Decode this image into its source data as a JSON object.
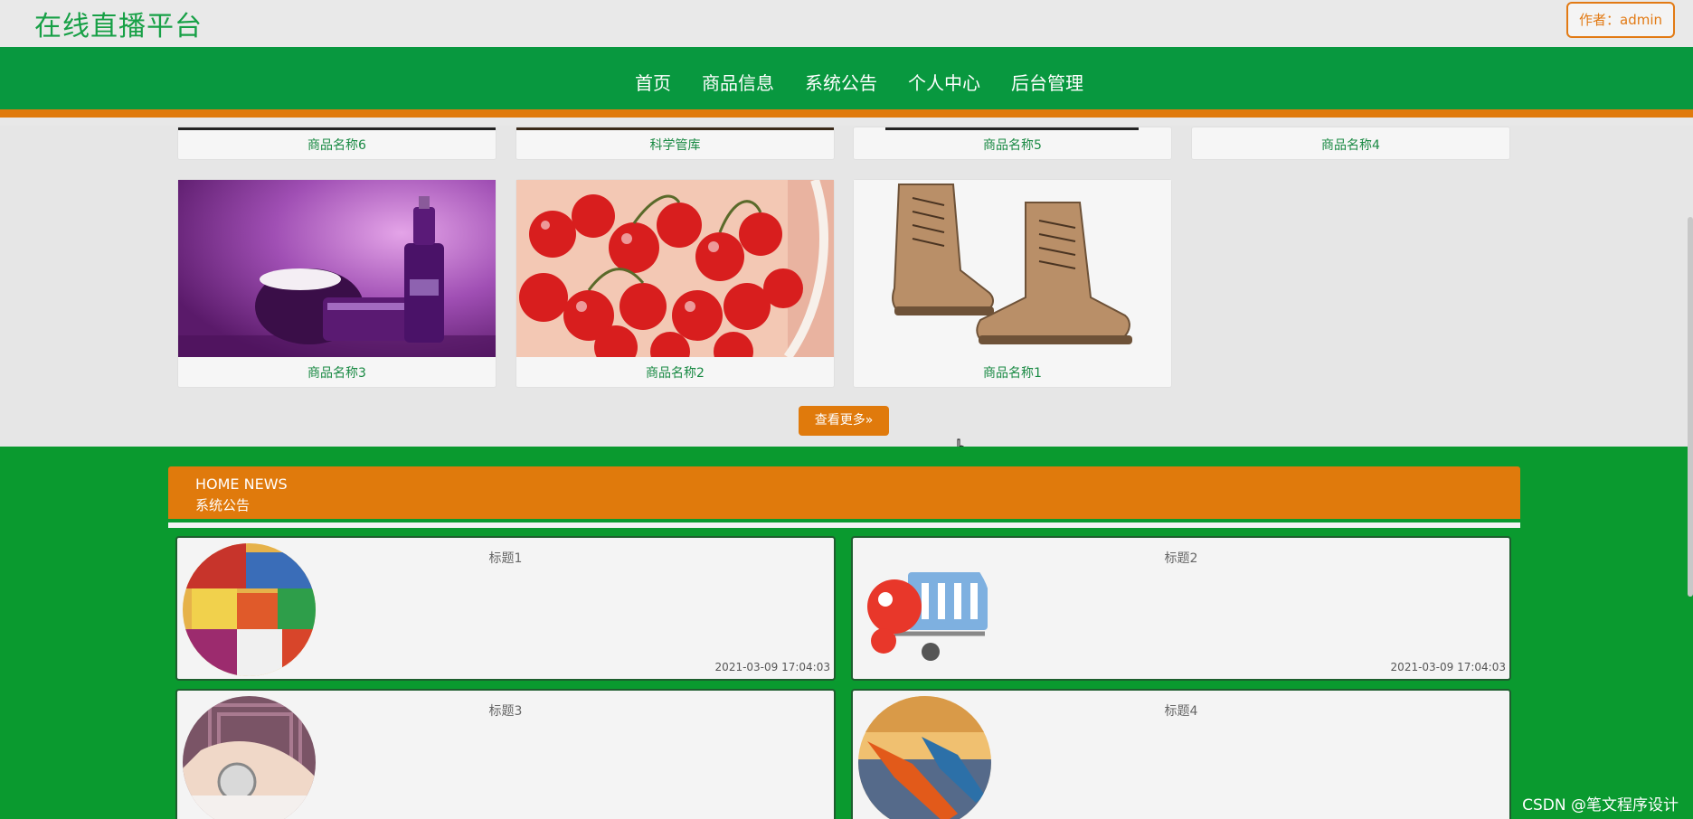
{
  "header": {
    "site_title": "在线直播平台",
    "author_label": "作者：admin"
  },
  "nav": {
    "items": [
      "首页",
      "商品信息",
      "系统公告",
      "个人中心",
      "后台管理"
    ]
  },
  "products": {
    "row1": [
      "商品名称6",
      "科学管库",
      "商品名称5",
      "商品名称4"
    ],
    "row2": [
      "商品名称3",
      "商品名称2",
      "商品名称1"
    ],
    "more_label": "查看更多»"
  },
  "news": {
    "heading_en": "HOME NEWS",
    "heading_zh": "系统公告",
    "items": [
      {
        "title": "标题1",
        "time": "2021-03-09 17:04:03"
      },
      {
        "title": "标题2",
        "time": "2021-03-09 17:04:03"
      },
      {
        "title": "标题3",
        "time": ""
      },
      {
        "title": "标题4",
        "time": ""
      }
    ]
  },
  "watermark": "CSDN @笔文程序设计",
  "colors": {
    "green": "#08983f",
    "orange": "#e07a0c",
    "news_bg": "#0a9a2f"
  }
}
